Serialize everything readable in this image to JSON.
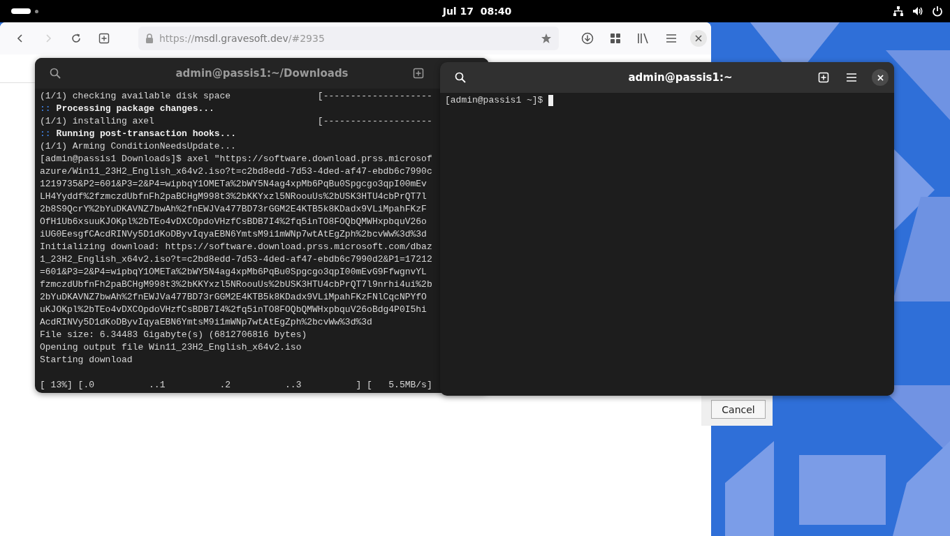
{
  "top_bar": {
    "clock": "Jul 17  08:40"
  },
  "browser": {
    "nav": [
      {
        "kind": "back",
        "disabled": false
      },
      {
        "kind": "forward",
        "disabled": true
      }
    ],
    "url": {
      "scheme": "https://",
      "host": "msdl.gravesoft.dev",
      "path": "/#2935"
    }
  },
  "dialog": {
    "buttons": [
      "Cancel"
    ]
  },
  "terminals": [
    {
      "title": "admin@passis1:~/Downloads",
      "active": false,
      "lines": [
        {
          "kind": "plain",
          "text": "(1/1) checking available disk space                [--------------------"
        },
        {
          "kind": "section",
          "marker": "::",
          "text": "Processing package changes..."
        },
        {
          "kind": "plain",
          "text": "(1/1) installing axel                              [--------------------"
        },
        {
          "kind": "section",
          "marker": "::",
          "text": "Running post-transaction hooks..."
        },
        {
          "kind": "plain",
          "text": "(1/1) Arming ConditionNeedsUpdate..."
        },
        {
          "kind": "plain",
          "text": "[admin@passis1 Downloads]$ axel \"https://software.download.prss.microsof"
        },
        {
          "kind": "plain",
          "text": "azure/Win11_23H2_English_x64v2.iso?t=c2bd8edd-7d53-4ded-af47-ebdb6c7990c"
        },
        {
          "kind": "plain",
          "text": "1219735&P2=601&P3=2&P4=wipbqY1OMETa%2bWY5N4ag4xpMb6PqBu0Spgcgo3qpI00mEv"
        },
        {
          "kind": "plain",
          "text": "LH4Yyddf%2fzmczdUbfnFh2paBCHgM998t3%2bKKYxzl5NRoouUs%2bUSK3HTU4cbPrQT7l"
        },
        {
          "kind": "plain",
          "text": "2b8S9QcrY%2bYuDKAVNZ7bwAh%2fnEWJVa477BD73rGGM2E4KTB5k8KDadx9VLiMpahFKzF"
        },
        {
          "kind": "plain",
          "text": "OfH1Ub6xsuuKJOKpl%2bTEo4vDXCOpdoVHzfCsBDB7I4%2fq5inTO8FOQbQMWHxpbquV26o"
        },
        {
          "kind": "plain",
          "text": "iUG0EesgfCAcdRINVy5D1dKoDByvIqyaEBN6YmtsM9i1mWNp7wtAtEgZph%2bcvWw%3d%3d"
        },
        {
          "kind": "plain",
          "text": "Initializing download: https://software.download.prss.microsoft.com/dbaz"
        },
        {
          "kind": "plain",
          "text": "1_23H2_English_x64v2.iso?t=c2bd8edd-7d53-4ded-af47-ebdb6c7990d2&P1=17212"
        },
        {
          "kind": "plain",
          "text": "=601&P3=2&P4=wipbqY1OMETa%2bWY5N4ag4xpMb6PqBu0Spgcgo3qpI00mEvG9FfwgnvYL"
        },
        {
          "kind": "plain",
          "text": "fzmczdUbfnFh2paBCHgM998t3%2bKKYxzl5NRoouUs%2bUSK3HTU4cbPrQT7l9nrhi4ui%2b"
        },
        {
          "kind": "plain",
          "text": "2bYuDKAVNZ7bwAh%2fnEWJVa477BD73rGGM2E4KTB5k8KDadx9VLiMpahFKzFNlCqcNPYfO"
        },
        {
          "kind": "plain",
          "text": "uKJOKpl%2bTEo4vDXCOpdoVHzfCsBDB7I4%2fq5inTO8FOQbQMWHxpbquV26oBdg4P0I5hi"
        },
        {
          "kind": "plain",
          "text": "AcdRINVy5D1dKoDByvIqyaEBN6YmtsM9i1mWNp7wtAtEgZph%2bcvWw%3d%3d"
        },
        {
          "kind": "plain",
          "text": "File size: 6.34483 Gigabyte(s) (6812706816 bytes)"
        },
        {
          "kind": "plain",
          "text": "Opening output file Win11_23H2_English_x64v2.iso"
        },
        {
          "kind": "plain",
          "text": "Starting download"
        },
        {
          "kind": "progress",
          "text": "[ 13%] [.0          ..1          .2          ..3          ] [   5.5MB/s]"
        }
      ]
    },
    {
      "title": "admin@passis1:~",
      "active": true,
      "lines": [
        {
          "kind": "prompt",
          "text": "[admin@passis1 ~]$ "
        }
      ]
    }
  ]
}
